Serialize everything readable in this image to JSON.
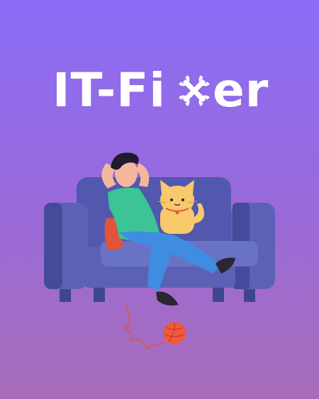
{
  "logo": {
    "text_left": "IT-Fi",
    "text_right": "er",
    "icon": "crossed-wrenches-icon"
  },
  "colors": {
    "background_top": "#8a6cf6",
    "background_bottom": "#a86db9",
    "sofa": "#5b62b6",
    "sofa_dark": "#3f4690",
    "shirt": "#3cc497",
    "pants": "#3e8de0",
    "cat": "#f7c96b",
    "yarn": "#ee5a3c"
  }
}
